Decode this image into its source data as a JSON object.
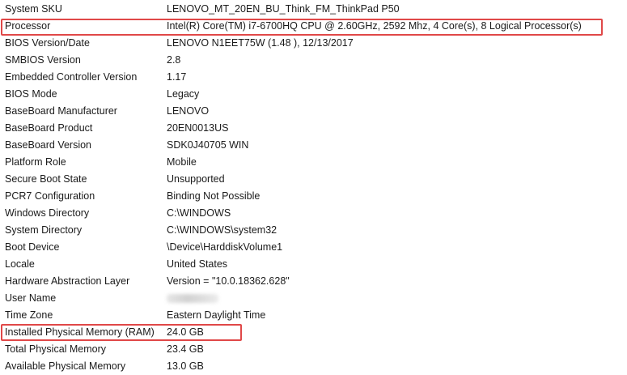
{
  "rows": [
    {
      "item": "System SKU",
      "value": "LENOVO_MT_20EN_BU_Think_FM_ThinkPad P50"
    },
    {
      "item": "Processor",
      "value": "Intel(R) Core(TM) i7-6700HQ CPU @ 2.60GHz, 2592 Mhz, 4 Core(s), 8 Logical Processor(s)"
    },
    {
      "item": "BIOS Version/Date",
      "value": "LENOVO N1EET75W (1.48 ), 12/13/2017"
    },
    {
      "item": "SMBIOS Version",
      "value": "2.8"
    },
    {
      "item": "Embedded Controller Version",
      "value": "1.17"
    },
    {
      "item": "BIOS Mode",
      "value": "Legacy"
    },
    {
      "item": "BaseBoard Manufacturer",
      "value": "LENOVO"
    },
    {
      "item": "BaseBoard Product",
      "value": "20EN0013US"
    },
    {
      "item": "BaseBoard Version",
      "value": "SDK0J40705 WIN"
    },
    {
      "item": "Platform Role",
      "value": "Mobile"
    },
    {
      "item": "Secure Boot State",
      "value": "Unsupported"
    },
    {
      "item": "PCR7 Configuration",
      "value": "Binding Not Possible"
    },
    {
      "item": "Windows Directory",
      "value": "C:\\WINDOWS"
    },
    {
      "item": "System Directory",
      "value": "C:\\WINDOWS\\system32"
    },
    {
      "item": "Boot Device",
      "value": "\\Device\\HarddiskVolume1"
    },
    {
      "item": "Locale",
      "value": "United States"
    },
    {
      "item": "Hardware Abstraction Layer",
      "value": "Version = \"10.0.18362.628\""
    },
    {
      "item": "User Name",
      "value": ""
    },
    {
      "item": "Time Zone",
      "value": "Eastern Daylight Time"
    },
    {
      "item": "Installed Physical Memory (RAM)",
      "value": "24.0 GB"
    },
    {
      "item": "Total Physical Memory",
      "value": "23.4 GB"
    },
    {
      "item": "Available Physical Memory",
      "value": "13.0 GB"
    }
  ],
  "colors": {
    "highlight": "#e04848",
    "text": "#1a1a1a",
    "background": "#ffffff"
  }
}
